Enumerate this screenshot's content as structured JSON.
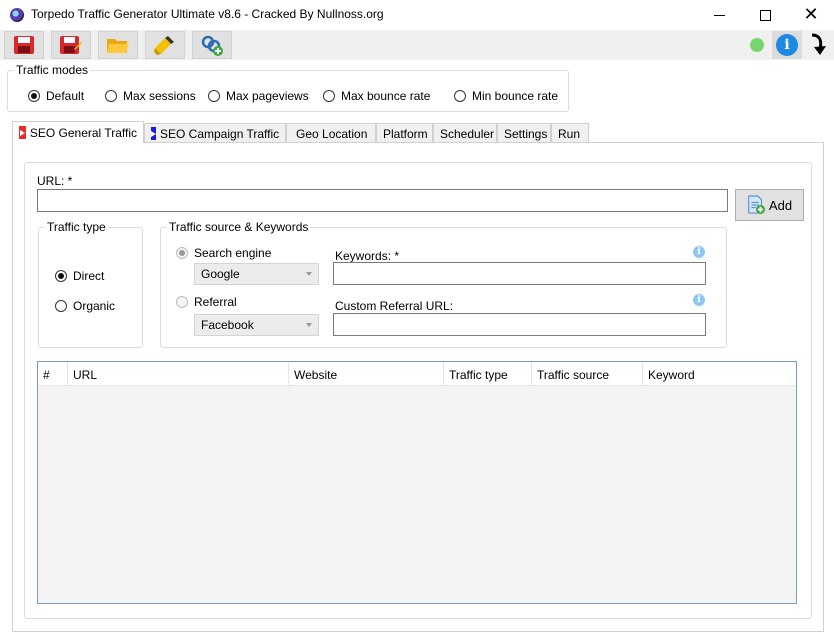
{
  "window": {
    "title": "Torpedo Traffic Generator Ultimate v8.6 - Cracked By Nullnoss.org"
  },
  "toolbar": {
    "buttons": [
      {
        "icon": "save-icon"
      },
      {
        "icon": "save-as-icon"
      },
      {
        "icon": "folder-open-icon"
      },
      {
        "icon": "clear-broom-icon"
      },
      {
        "icon": "add-link-icon"
      }
    ],
    "status_color": "#77d66b",
    "info_glyph": "i"
  },
  "traffic_modes": {
    "legend": "Traffic modes",
    "options": [
      "Default",
      "Max sessions",
      "Max pageviews",
      "Max bounce rate",
      "Min bounce rate"
    ],
    "selected": "Default"
  },
  "tabs": [
    {
      "label": "SEO General Traffic",
      "active": true
    },
    {
      "label": "SEO Campaign Traffic"
    },
    {
      "label": "Geo Location"
    },
    {
      "label": "Platform"
    },
    {
      "label": "Scheduler"
    },
    {
      "label": "Settings"
    },
    {
      "label": "Run"
    }
  ],
  "seo_general": {
    "url_label": "URL: *",
    "url_value": "",
    "add_label": "Add",
    "traffic_type": {
      "legend": "Traffic type",
      "options": [
        "Direct",
        "Organic"
      ],
      "selected": "Direct"
    },
    "traffic_source": {
      "legend": "Traffic source & Keywords",
      "search_engine_label": "Search engine",
      "search_engine_value": "Google",
      "referral_label": "Referral",
      "referral_value": "Facebook",
      "keywords_label": "Keywords: *",
      "keywords_value": "",
      "custom_referral_label": "Custom Referral URL:",
      "custom_referral_value": "",
      "info_glyph": "i"
    },
    "table": {
      "columns": [
        "#",
        "URL",
        "Website",
        "Traffic type",
        "Traffic source",
        "Keyword"
      ],
      "rows": []
    }
  }
}
